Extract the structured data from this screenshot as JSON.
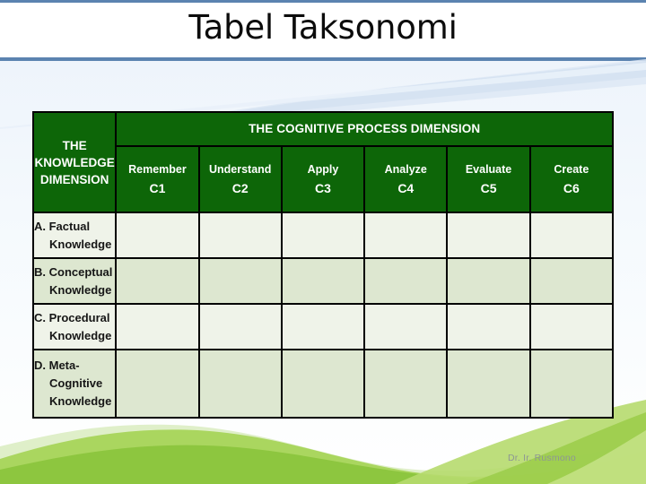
{
  "slide": {
    "title": "Tabel Taksonomi",
    "watermark": "Dr. Ir. Rusmono"
  },
  "colors": {
    "header_green": "#0d6608",
    "rule_blue": "#5b83b0",
    "row_odd": "#eff3e9",
    "row_even": "#dde7d0",
    "grid_line": "#000000",
    "hill_green": "#8dc63f",
    "background": "#f4f9fd"
  },
  "table": {
    "knowledge_dimension_header": {
      "line1": "THE",
      "line2": "KNOWLEDGE",
      "line3": "DIMENSION"
    },
    "cognitive_process_header": "THE COGNITIVE PROCESS DIMENSION",
    "columns": [
      {
        "verb": "Remember",
        "code": "C1"
      },
      {
        "verb": "Understand",
        "code": "C2"
      },
      {
        "verb": "Apply",
        "code": "C3"
      },
      {
        "verb": "Analyze",
        "code": "C4"
      },
      {
        "verb": "Evaluate",
        "code": "C5"
      },
      {
        "verb": "Create",
        "code": "C6"
      }
    ],
    "rows": [
      {
        "line1": "A. Factual",
        "line2": "Knowledge",
        "line3": ""
      },
      {
        "line1": "B. Conceptual",
        "line2": "Knowledge",
        "line3": ""
      },
      {
        "line1": "C. Procedural",
        "line2": "Knowledge",
        "line3": ""
      },
      {
        "line1": "D. Meta-",
        "line2": "Cognitive",
        "line3": "Knowledge"
      }
    ],
    "cells": [
      [
        "",
        "",
        "",
        "",
        "",
        ""
      ],
      [
        "",
        "",
        "",
        "",
        "",
        ""
      ],
      [
        "",
        "",
        "",
        "",
        "",
        ""
      ],
      [
        "",
        "",
        "",
        "",
        "",
        ""
      ]
    ]
  }
}
